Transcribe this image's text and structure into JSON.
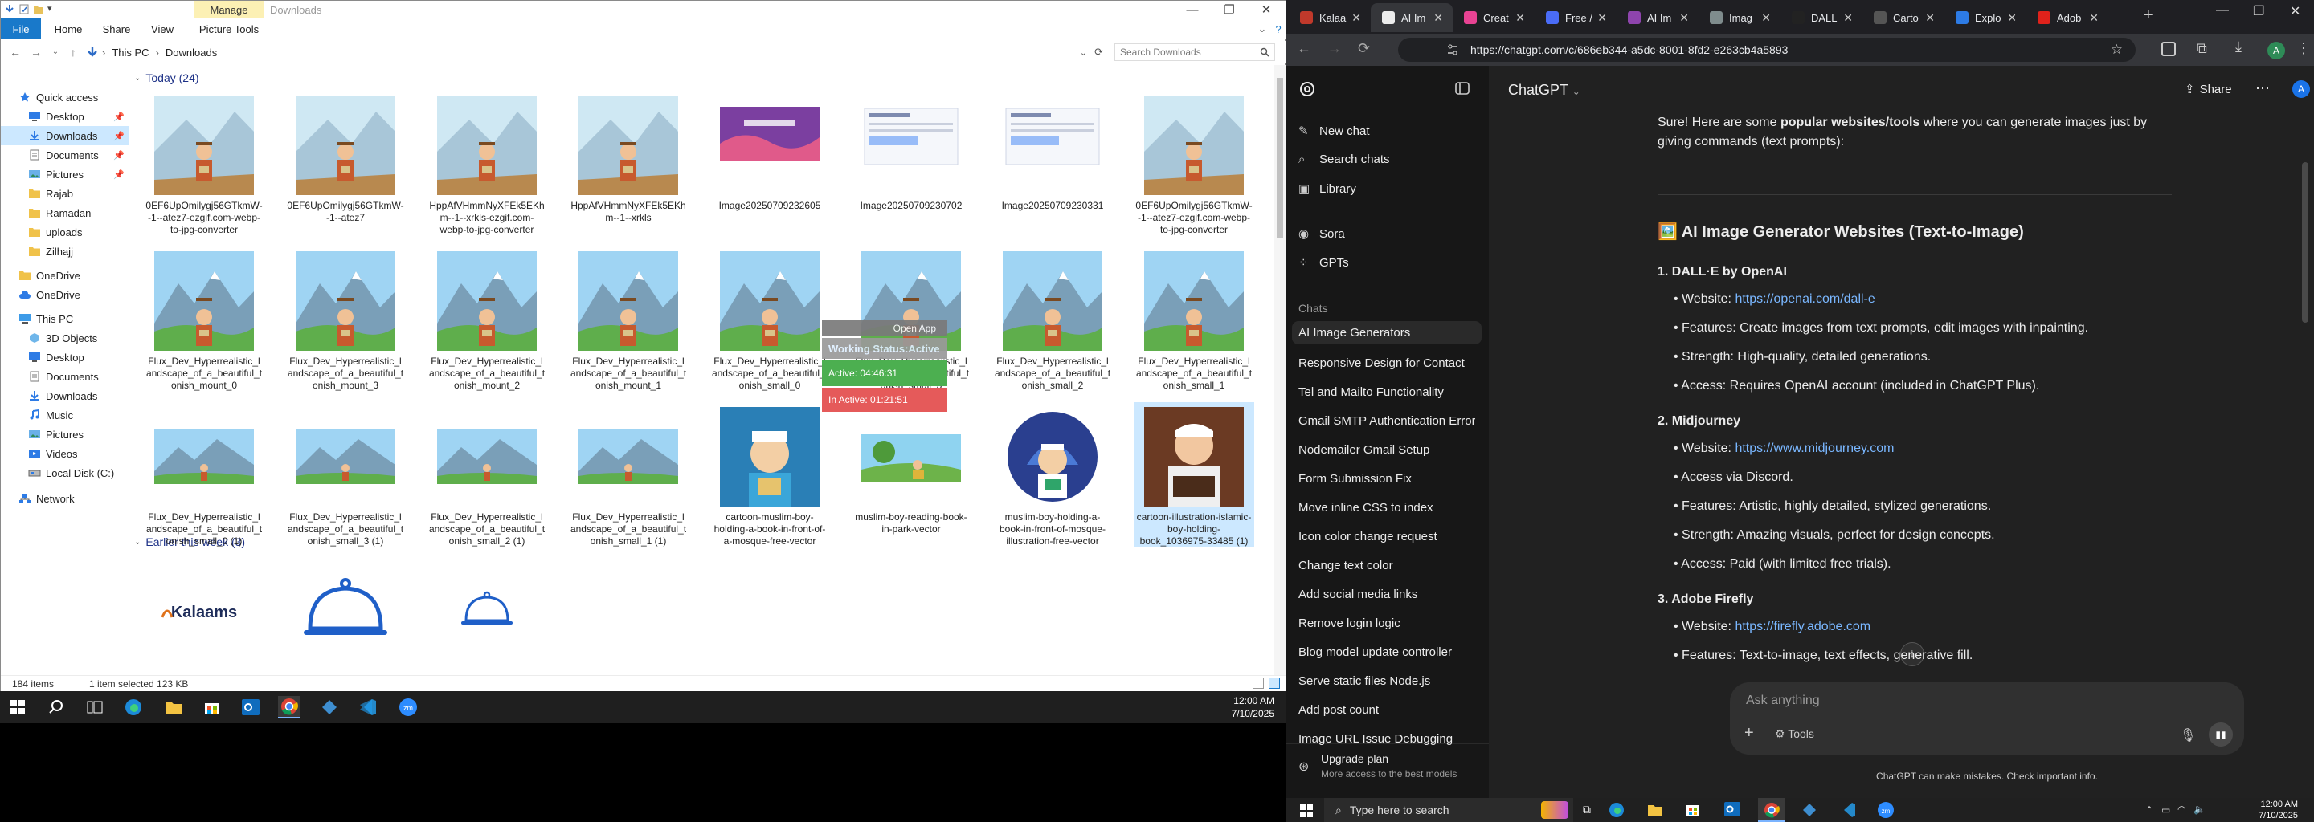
{
  "explorer": {
    "ribbon_tabs": [
      "File",
      "Home",
      "Share",
      "View",
      "Picture Tools"
    ],
    "manage_tab": "Manage",
    "window_title": "Downloads",
    "breadcrumb": [
      "This PC",
      "Downloads"
    ],
    "search_placeholder": "Search Downloads",
    "nav": [
      {
        "label": "Quick access",
        "icon": "star-icon",
        "indent": 0
      },
      {
        "label": "Desktop",
        "icon": "desktop-icon",
        "indent": 1,
        "pin": true
      },
      {
        "label": "Downloads",
        "icon": "download-icon",
        "indent": 1,
        "pin": true,
        "selected": true
      },
      {
        "label": "Documents",
        "icon": "documents-icon",
        "indent": 1,
        "pin": true
      },
      {
        "label": "Pictures",
        "icon": "pictures-icon",
        "indent": 1,
        "pin": true
      },
      {
        "label": "Rajab",
        "icon": "folder-icon",
        "indent": 1
      },
      {
        "label": "Ramadan",
        "icon": "folder-icon",
        "indent": 1
      },
      {
        "label": "uploads",
        "icon": "folder-icon",
        "indent": 1
      },
      {
        "label": "Zilhajj",
        "icon": "folder-icon",
        "indent": 1
      },
      {
        "label": "OneDrive",
        "icon": "folder-icon",
        "indent": 0
      },
      {
        "label": "OneDrive",
        "icon": "cloud-icon",
        "indent": 0
      },
      {
        "label": "This PC",
        "icon": "pc-icon",
        "indent": 0
      },
      {
        "label": "3D Objects",
        "icon": "cube-icon",
        "indent": 1
      },
      {
        "label": "Desktop",
        "icon": "desktop-icon",
        "indent": 1
      },
      {
        "label": "Documents",
        "icon": "documents-icon",
        "indent": 1
      },
      {
        "label": "Downloads",
        "icon": "download-icon",
        "indent": 1
      },
      {
        "label": "Music",
        "icon": "music-icon",
        "indent": 1
      },
      {
        "label": "Pictures",
        "icon": "pictures-icon",
        "indent": 1
      },
      {
        "label": "Videos",
        "icon": "videos-icon",
        "indent": 1
      },
      {
        "label": "Local Disk (C:)",
        "icon": "drive-icon",
        "indent": 1
      },
      {
        "label": "Network",
        "icon": "network-icon",
        "indent": 0
      }
    ],
    "group_today": "Today (24)",
    "group_week": "Earlier this week (3)",
    "files": [
      {
        "name": "0EF6UpOmilygj56GTkmW--1--atez7-ezgif.com-webp-to-jpg-converter",
        "kind": "boy"
      },
      {
        "name": "0EF6UpOmilygj56GTkmW--1--atez7",
        "kind": "boy"
      },
      {
        "name": "HppAfVHmmNyXFEk5EKhm--1--xrkls-ezgif.com-webp-to-jpg-converter",
        "kind": "boy"
      },
      {
        "name": "HppAfVHmmNyXFEk5EKhm--1--xrkls",
        "kind": "boy"
      },
      {
        "name": "Image20250709232605",
        "kind": "poster"
      },
      {
        "name": "Image20250709230702",
        "kind": "doc"
      },
      {
        "name": "Image20250709230331",
        "kind": "doc"
      },
      {
        "name": "0EF6UpOmilygj56GTkmW--1--atez7-ezgif.com-webp-to-jpg-converter",
        "kind": "boy"
      },
      {
        "name": "Flux_Dev_Hyperrealistic_landscape_of_a_beautiful_tonish_mount_0",
        "kind": "mount"
      },
      {
        "name": "Flux_Dev_Hyperrealistic_landscape_of_a_beautiful_tonish_mount_3",
        "kind": "mount"
      },
      {
        "name": "Flux_Dev_Hyperrealistic_landscape_of_a_beautiful_tonish_mount_2",
        "kind": "mount"
      },
      {
        "name": "Flux_Dev_Hyperrealistic_landscape_of_a_beautiful_tonish_mount_1",
        "kind": "mount"
      },
      {
        "name": "Flux_Dev_Hyperrealistic_landscape_of_a_beautiful_tonish_small_0",
        "kind": "mount"
      },
      {
        "name": "Flux_Dev_Hyperrealistic_landscape_of_a_beautiful_tonish_small_3",
        "kind": "mount"
      },
      {
        "name": "Flux_Dev_Hyperrealistic_landscape_of_a_beautiful_tonish_small_2",
        "kind": "mount"
      },
      {
        "name": "Flux_Dev_Hyperrealistic_landscape_of_a_beautiful_tonish_small_1",
        "kind": "mount"
      },
      {
        "name": "Flux_Dev_Hyperrealistic_landscape_of_a_beautiful_tonish_small_0 (1)",
        "kind": "wide"
      },
      {
        "name": "Flux_Dev_Hyperrealistic_landscape_of_a_beautiful_tonish_small_3 (1)",
        "kind": "wide"
      },
      {
        "name": "Flux_Dev_Hyperrealistic_landscape_of_a_beautiful_tonish_small_2 (1)",
        "kind": "wide"
      },
      {
        "name": "Flux_Dev_Hyperrealistic_landscape_of_a_beautiful_tonish_small_1 (1)",
        "kind": "wide"
      },
      {
        "name": "cartoon-muslim-boy-holding-a-book-in-front-of-a-mosque-free-vector",
        "kind": "muslimboy"
      },
      {
        "name": "muslim-boy-reading-book-in-park-vector",
        "kind": "park"
      },
      {
        "name": "muslim-boy-holding-a-book-in-front-of-mosque-illustration-free-vector",
        "kind": "mosque"
      },
      {
        "name": "cartoon-illustration-islamic-boy-holding-book_1036975-33485 (1)",
        "kind": "islamic",
        "selected": true
      }
    ],
    "week_files": [
      {
        "kind": "logo",
        "logo_text": "Kalaams"
      },
      {
        "kind": "cloche"
      },
      {
        "kind": "cloche-small"
      }
    ],
    "status_items": "184 items",
    "status_selected": "1 item selected  123 KB",
    "overlay": {
      "open_app": "Open App",
      "working": "Working Status:Active",
      "active": "Active: 04:46:31",
      "inactive": "In Active: 01:21:51"
    }
  },
  "taskbar_left": {
    "time": "12:00 AM",
    "date": "7/10/2025"
  },
  "chrome": {
    "tabs": [
      {
        "title": "Kalaa",
        "color": "#c0392b",
        "active": false
      },
      {
        "title": "AI Im",
        "color": "#ececec",
        "active": true
      },
      {
        "title": "Creat",
        "color": "#e84393",
        "active": false
      },
      {
        "title": "Free /",
        "color": "#4a6cf7",
        "active": false
      },
      {
        "title": "AI Im",
        "color": "#8e44ad",
        "active": false
      },
      {
        "title": "Imag",
        "color": "#7f8c8d",
        "active": false
      },
      {
        "title": "DALL",
        "color": "#222",
        "active": false
      },
      {
        "title": "Carto",
        "color": "#555",
        "active": false
      },
      {
        "title": "Explo",
        "color": "#2d7be5",
        "active": false
      },
      {
        "title": "Adob",
        "color": "#e0221b",
        "active": false
      }
    ],
    "url": "https://chatgpt.com/c/686eb344-a5dc-8001-8fd2-e263cb4a5893",
    "profile_letter": "A"
  },
  "gpt": {
    "model": "ChatGPT",
    "share": "Share",
    "menu": [
      "New chat",
      "Search chats",
      "Library"
    ],
    "extras": [
      "Sora",
      "GPTs"
    ],
    "chats_heading": "Chats",
    "chats": [
      "AI Image Generators",
      "Responsive Design for Contact",
      "Tel and Mailto Functionality",
      "Gmail SMTP Authentication Error",
      "Nodemailer Gmail Setup",
      "Form Submission Fix",
      "Move inline CSS to index",
      "Icon color change request",
      "Change text color",
      "Add social media links",
      "Remove login logic",
      "Blog model update controller",
      "Serve static files Node.js",
      "Add post count",
      "Image URL Issue Debugging"
    ],
    "upgrade_title": "Upgrade plan",
    "upgrade_sub": "More access to the best models",
    "intro_1": "Sure! Here are some ",
    "intro_bold": "popular websites/tools",
    "intro_2": " where you can generate images just by",
    "intro_3": "giving commands (text prompts):",
    "heading_emoji": "🖼️",
    "heading": "AI Image Generator Websites (Text-to-Image)",
    "sections": [
      {
        "title": "1. DALL·E by OpenAI",
        "items": [
          {
            "label": "Website: ",
            "link": "https://openai.com/dall-e"
          },
          {
            "label": "Features: Create images from text prompts, edit images with inpainting."
          },
          {
            "label": "Strength: High-quality, detailed generations."
          },
          {
            "label": "Access: Requires OpenAI account (included in ChatGPT Plus)."
          }
        ]
      },
      {
        "title": "2. Midjourney",
        "items": [
          {
            "label": "Website: ",
            "link": "https://www.midjourney.com"
          },
          {
            "label": "Access via Discord."
          },
          {
            "label": "Features: Artistic, highly detailed, stylized generations."
          },
          {
            "label": "Strength: Amazing visuals, perfect for design concepts."
          },
          {
            "label": "Access: Paid (with limited free trials)."
          }
        ]
      },
      {
        "title": "3. Adobe Firefly",
        "items": [
          {
            "label": "Website: ",
            "link": "https://firefly.adobe.com"
          },
          {
            "label": "Features: Text-to-image, text effects, generative fill."
          }
        ]
      }
    ],
    "input_placeholder": "Ask anything",
    "tools": "Tools",
    "disclaimer": "ChatGPT can make mistakes. Check important info."
  },
  "taskbar_right": {
    "search_placeholder": "Type here to search",
    "time": "12:00 AM",
    "date": "7/10/2025"
  }
}
